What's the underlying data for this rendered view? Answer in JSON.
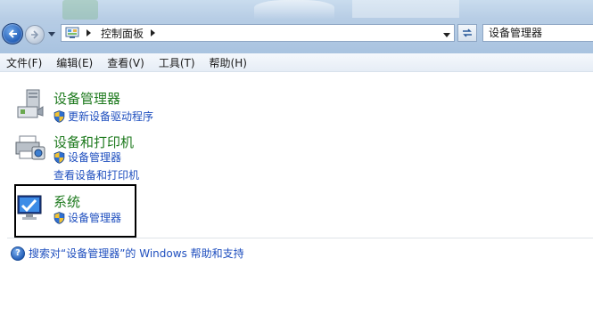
{
  "address_bar": {
    "breadcrumb": "控制面板"
  },
  "search": {
    "value": "设备管理器"
  },
  "menu": {
    "items": [
      "文件(F)",
      "编辑(E)",
      "查看(V)",
      "工具(T)",
      "帮助(H)"
    ]
  },
  "results": [
    {
      "title": "设备管理器",
      "icon": "device-manager-icon",
      "tasks": [
        {
          "label": "更新设备驱动程序",
          "shield": true
        }
      ]
    },
    {
      "title": "设备和打印机",
      "icon": "printer-camera-icon",
      "tasks": [
        {
          "label": "设备管理器",
          "shield": true
        },
        {
          "label": "查看设备和打印机",
          "shield": false
        }
      ]
    },
    {
      "title": "系统",
      "icon": "system-monitor-icon",
      "tasks": [
        {
          "label": "设备管理器",
          "shield": true
        }
      ]
    }
  ],
  "help": {
    "text": "搜索对“设备管理器”的 Windows 帮助和支持"
  },
  "colors": {
    "title_green": "#1e7a1e",
    "link_blue": "#1f4fbf",
    "highlight_border": "#000000"
  }
}
